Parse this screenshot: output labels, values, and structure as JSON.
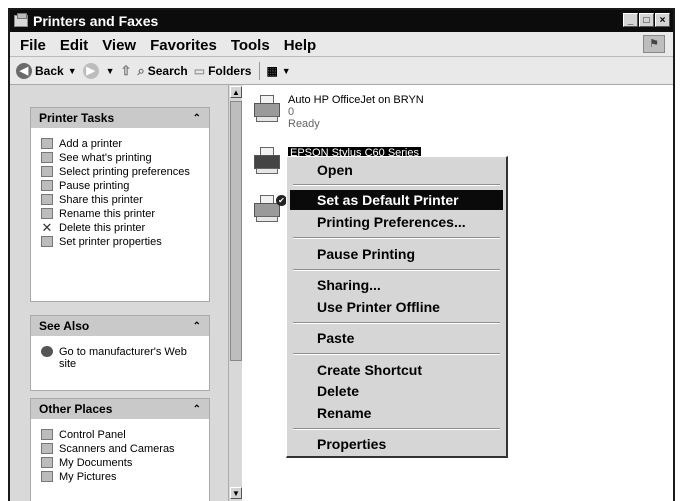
{
  "window": {
    "title": "Printers and Faxes",
    "controls": [
      "_",
      "□",
      "×"
    ]
  },
  "menubar": [
    "File",
    "Edit",
    "View",
    "Favorites",
    "Tools",
    "Help"
  ],
  "toolbar": {
    "back": "Back",
    "search": "Search",
    "folders": "Folders"
  },
  "panels": {
    "printer_tasks": {
      "title": "Printer Tasks",
      "items": [
        "Add a printer",
        "See what's printing",
        "Select printing preferences",
        "Pause printing",
        "Share this printer",
        "Rename this printer",
        "Delete this printer",
        "Set printer properties"
      ]
    },
    "see_also": {
      "title": "See Also",
      "items": [
        "Go to manufacturer's Web site"
      ]
    },
    "other_places": {
      "title": "Other Places",
      "items": [
        "Control Panel",
        "Scanners and Cameras",
        "My Documents",
        "My Pictures"
      ]
    }
  },
  "printers": [
    {
      "name": "Auto HP OfficeJet on BRYN",
      "docs": "0",
      "status": "Ready"
    },
    {
      "name": "EPSON Stylus C60 Series",
      "selected": true
    },
    {
      "name": "",
      "default": true
    }
  ],
  "context_menu": [
    {
      "label": "Open",
      "group": 1
    },
    {
      "label": "Set as Default Printer",
      "group": 2,
      "highlighted": true
    },
    {
      "label": "Printing Preferences...",
      "group": 2
    },
    {
      "label": "Pause Printing",
      "group": 3
    },
    {
      "label": "Sharing...",
      "group": 4
    },
    {
      "label": "Use Printer Offline",
      "group": 4
    },
    {
      "label": "Paste",
      "group": 5
    },
    {
      "label": "Create Shortcut",
      "group": 6
    },
    {
      "label": "Delete",
      "group": 6
    },
    {
      "label": "Rename",
      "group": 6
    },
    {
      "label": "Properties",
      "group": 7
    }
  ]
}
